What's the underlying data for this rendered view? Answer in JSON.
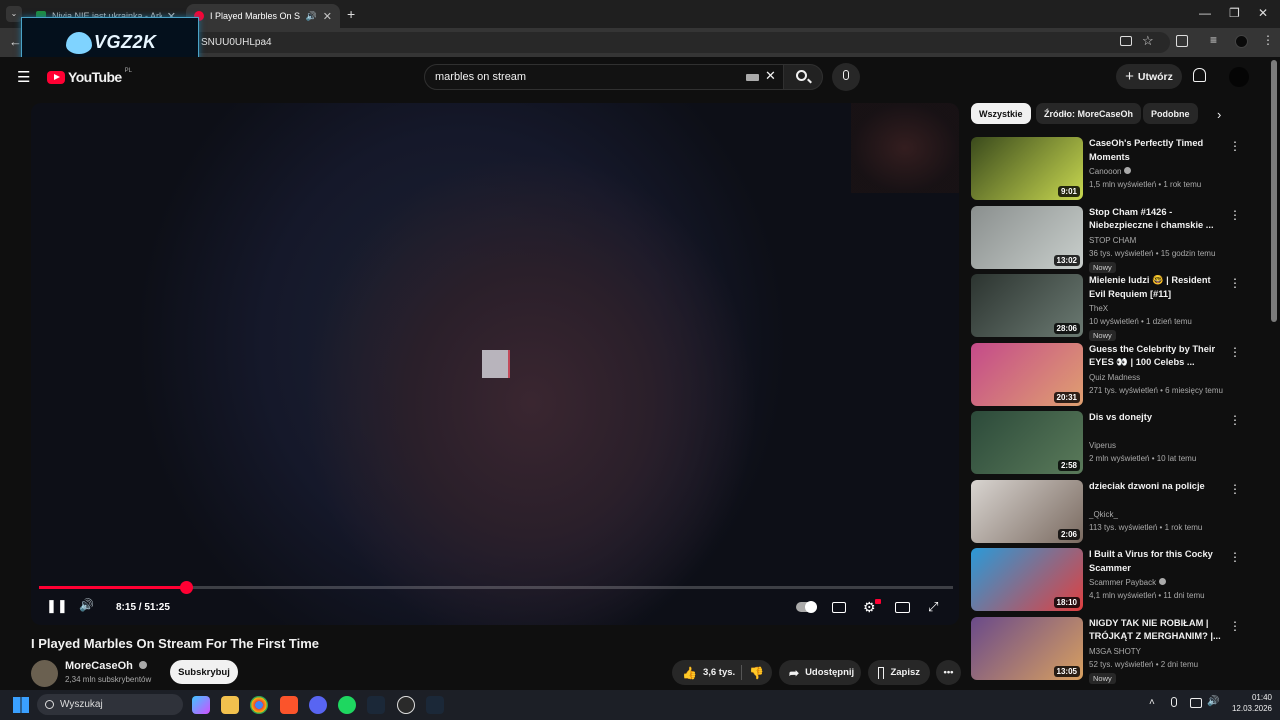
{
  "browser": {
    "tabs": [
      {
        "title": "Nivia NIE jest ukrainką - Arkusz"
      },
      {
        "title": "I Played Marbles On Stream For"
      }
    ],
    "url_fragment": "SNUU0UHLpa4"
  },
  "overlay": {
    "logo_text": "VGZ2K"
  },
  "youtube": {
    "logo_text": "YouTube",
    "country_code": "PL",
    "search_value": "marbles on stream",
    "create_label": "Utwórz"
  },
  "player": {
    "time_display": "8:15 / 51:25",
    "progress_fraction": 0.1604,
    "title": "I Played Marbles On Stream For The First Time",
    "channel_name": "MoreCaseOh",
    "subscribers": "2,34 mln subskrybentów",
    "subscribe_label": "Subskrybuj",
    "likes": "3,6 tys.",
    "share_label": "Udostępnij",
    "save_label": "Zapisz"
  },
  "sidebar": {
    "chips": [
      "Wszystkie",
      "Źródło: MoreCaseOh",
      "Podobne"
    ],
    "videos": [
      {
        "title": "CaseOh's Perfectly Timed Moments",
        "channel": "Canooon",
        "verified": true,
        "meta": "1,5 mln wyświetleń • 1 rok temu",
        "duration": "9:01",
        "badge": "",
        "colors": [
          "#3a4a1c",
          "#c8d850"
        ]
      },
      {
        "title": "Stop Cham #1426 - Niebezpieczne i chamskie ...",
        "channel": "STOP CHAM",
        "verified": false,
        "meta": "36 tys. wyświetleń • 15 godzin temu",
        "duration": "13:02",
        "badge": "Nowy",
        "colors": [
          "#8a8f8e",
          "#c9cfcc"
        ]
      },
      {
        "title": "Mielenie ludzi 🤓 | Resident Evil Requiem [#11]",
        "channel": "TheX",
        "verified": false,
        "meta": "10 wyświetleń • 1 dzień temu",
        "duration": "28:06",
        "badge": "Nowy",
        "colors": [
          "#2c3430",
          "#6b7a72"
        ]
      },
      {
        "title": "Guess the Celebrity by Their EYES 👀 | 100 Celebs ...",
        "channel": "Quiz Madness",
        "verified": false,
        "meta": "271 tys. wyświetleń • 6 miesięcy temu",
        "duration": "20:31",
        "badge": "",
        "colors": [
          "#c44a8a",
          "#e0a070"
        ]
      },
      {
        "title": "Dis vs donejty",
        "channel": "Viperus",
        "verified": false,
        "meta": "2 mln wyświetleń • 10 lat temu",
        "duration": "2:58",
        "badge": "",
        "colors": [
          "#2c4a3a",
          "#5a7a5a"
        ]
      },
      {
        "title": "dzieciak dzwoni na policje",
        "channel": "_Qkick_",
        "verified": false,
        "meta": "113 tys. wyświetleń • 1 rok temu",
        "duration": "2:06",
        "badge": "",
        "colors": [
          "#d8d4d0",
          "#7a6a60"
        ]
      },
      {
        "title": "I Built a Virus for this Cocky Scammer",
        "channel": "Scammer Payback",
        "verified": true,
        "meta": "4,1 mln wyświetleń • 11 dni temu",
        "duration": "18:10",
        "badge": "",
        "colors": [
          "#2a9ad8",
          "#e04040"
        ]
      },
      {
        "title": "NIGDY TAK NIE ROBIŁAM | TRÓJKĄT Z MERGHANIM? |...",
        "channel": "M3GA SHOTY",
        "verified": false,
        "meta": "52 tys. wyświetleń • 2 dni temu",
        "duration": "13:05",
        "badge": "Nowy",
        "colors": [
          "#6a4a8a",
          "#d8a060"
        ]
      }
    ]
  },
  "taskbar": {
    "search_placeholder": "Wyszukaj",
    "time": "01:40",
    "date": "12.03.2026"
  }
}
